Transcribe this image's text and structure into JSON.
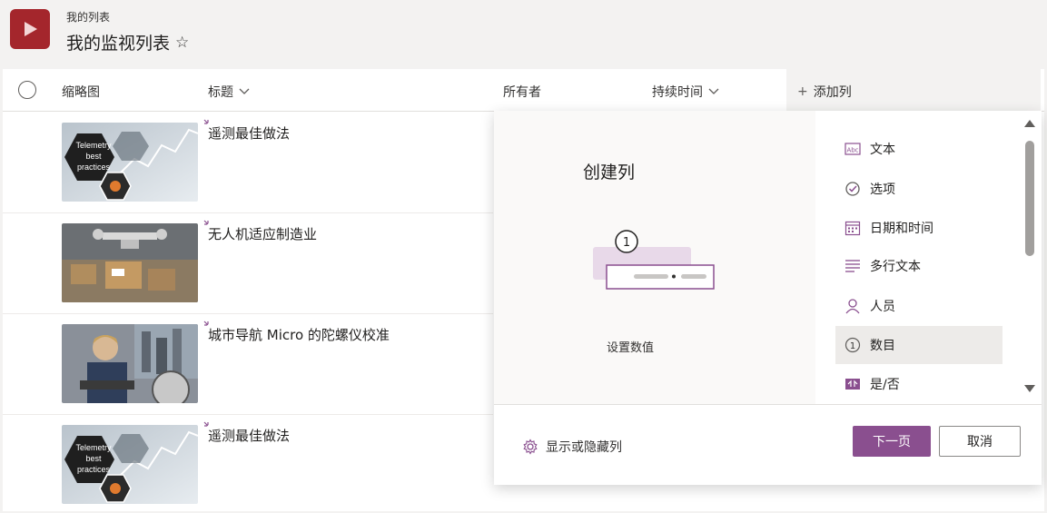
{
  "header": {
    "breadcrumb": "我的列表",
    "title": "我的监视列表",
    "star_icon": "star-outline-icon",
    "app_icon": "play-icon",
    "accent": "#a4262c"
  },
  "columns": {
    "thumbnail": "缩略图",
    "title": "标题",
    "owner": "所有者",
    "duration": "持续时间",
    "add_column": "添加列"
  },
  "rows": [
    {
      "title": "遥测最佳做法",
      "thumb_text": [
        "Telemetry",
        "best",
        "practices"
      ]
    },
    {
      "title": "无人机适应制造业"
    },
    {
      "title": "城市导航 Micro 的陀螺仪校准"
    },
    {
      "title": "遥测最佳做法",
      "thumb_text": [
        "Telemetry",
        "best",
        "practices"
      ]
    }
  ],
  "flyout": {
    "heading": "创建列",
    "preview_caption": "设置数值",
    "preview_number": "1",
    "types": [
      {
        "label": "文本",
        "icon": "text-abc-icon"
      },
      {
        "label": "选项",
        "icon": "choice-check-icon"
      },
      {
        "label": "日期和时间",
        "icon": "calendar-icon"
      },
      {
        "label": "多行文本",
        "icon": "multiline-text-icon"
      },
      {
        "label": "人员",
        "icon": "person-icon"
      },
      {
        "label": "数目",
        "icon": "number-icon",
        "selected": true
      },
      {
        "label": "是/否",
        "icon": "yes-no-icon"
      }
    ],
    "show_hide": "显示或隐藏列",
    "next_button": "下一页",
    "cancel_button": "取消",
    "primary_color": "#8a4f8f"
  }
}
